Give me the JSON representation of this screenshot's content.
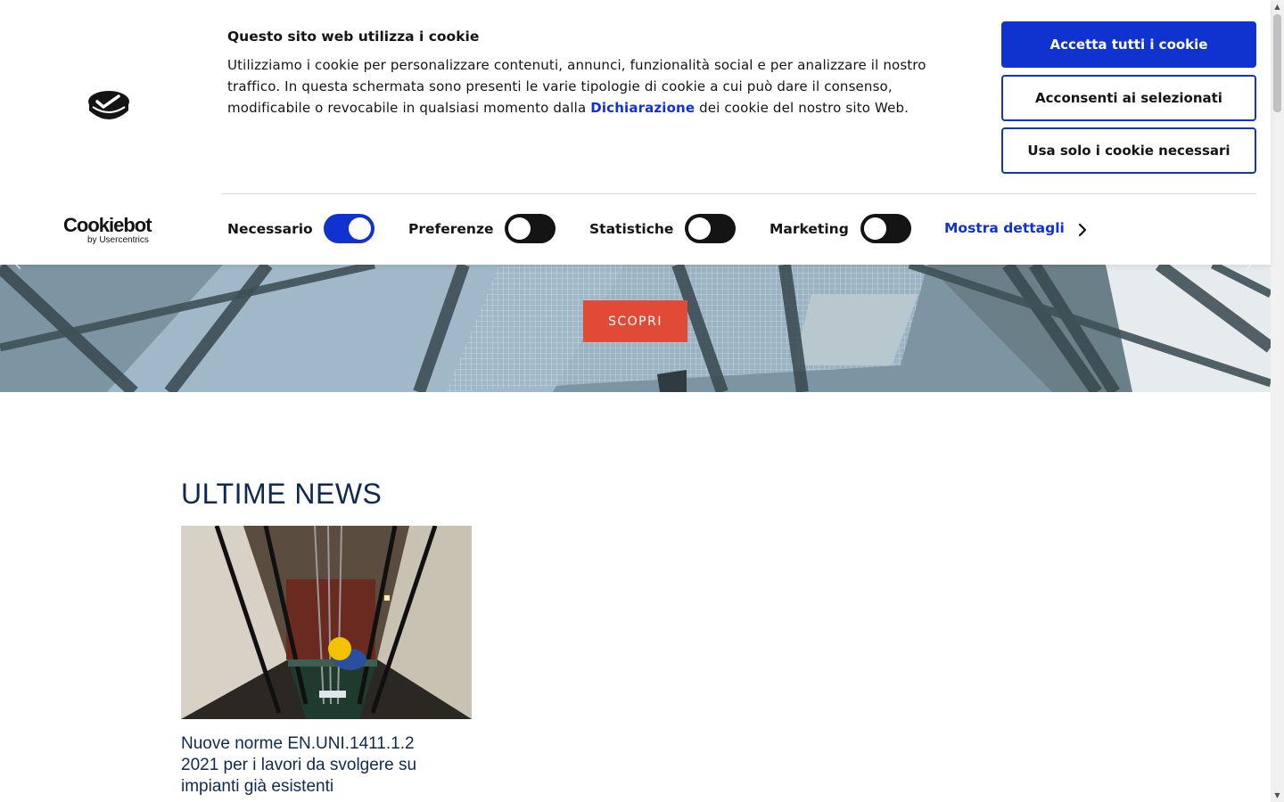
{
  "cookie_banner": {
    "title": "Questo sito web utilizza i cookie",
    "text_before_link": "Utilizziamo i cookie per personalizzare contenuti, annunci, funzionalità social e per analizzare il nostro traffico. In questa schermata sono presenti le varie tipologie di cookie a cui può dare il consenso, modificabile o revocabile in qualsiasi momento dalla ",
    "link_label": "Dichiarazione",
    "text_after_link": " dei cookie del nostro sito Web.",
    "buttons": {
      "accept_all": "Accetta tutti i cookie",
      "accept_selected": "Acconsenti ai selezionati",
      "necessary_only": "Usa solo i cookie necessari"
    },
    "brand": {
      "name": "Cookiebot",
      "sub": "by Usercentrics"
    },
    "toggles": [
      {
        "label": "Necessario",
        "on": true
      },
      {
        "label": "Preferenze",
        "on": false
      },
      {
        "label": "Statistiche",
        "on": false
      },
      {
        "label": "Marketing",
        "on": false
      }
    ],
    "details_label": "Mostra dettagli",
    "colors": {
      "accent": "#1032cf",
      "text": "#141414",
      "switch_off": "#141414"
    }
  },
  "hero": {
    "cta_label": "SCOPRI",
    "cta_color": "#e04a36",
    "prev_icon": "chevron-left-icon",
    "next_icon": "chevron-right-icon"
  },
  "news": {
    "heading": "ULTIME NEWS",
    "items": [
      {
        "title": "Nuove norme EN.UNI.1411.1.2 2021 per i lavori da svolgere su impianti già esistenti"
      }
    ],
    "heading_color": "#0f2a52"
  }
}
